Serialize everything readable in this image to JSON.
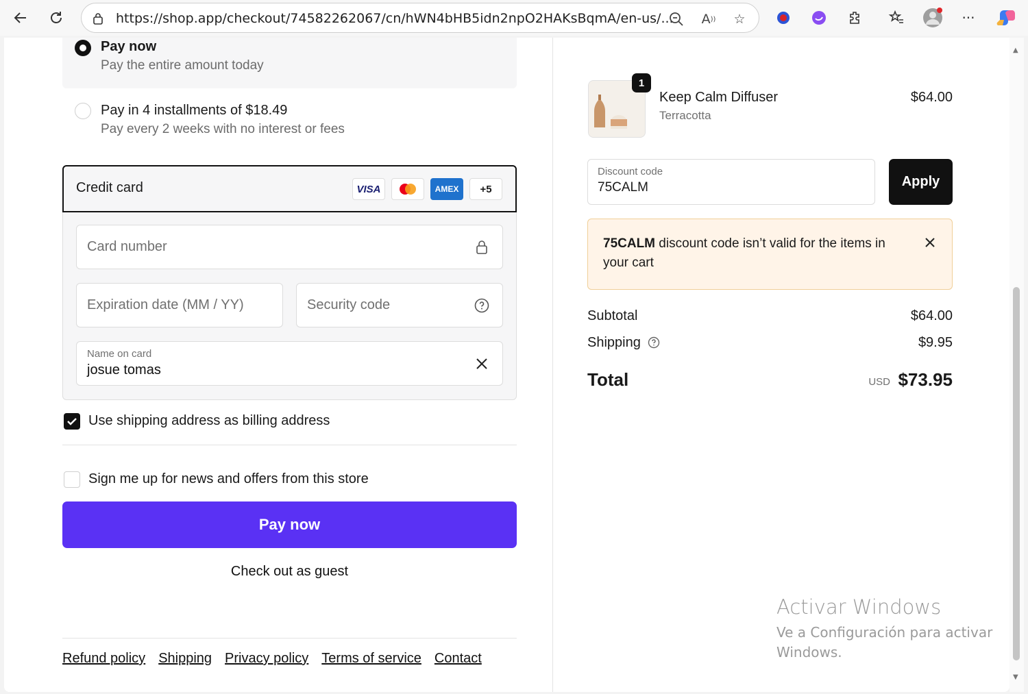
{
  "browser": {
    "url": "https://shop.app/checkout/74582262067/cn/hWN4bHB5idn2npO2HAKsBqmA/en-us/..."
  },
  "payment_options": [
    {
      "title": "Pay now",
      "subtitle": "Pay the entire amount today",
      "selected": true
    },
    {
      "title": "Pay in 4 installments of $18.49",
      "subtitle": "Pay every 2 weeks with no interest or fees",
      "selected": false
    }
  ],
  "credit_card": {
    "heading": "Credit card",
    "brands": [
      "VISA",
      "Mastercard",
      "AMEX",
      "+5"
    ],
    "card_number_placeholder": "Card number",
    "expiration_placeholder": "Expiration date (MM / YY)",
    "security_placeholder": "Security code",
    "name_label": "Name on card",
    "name_value": "josue tomas"
  },
  "billing_checkbox": {
    "label": "Use shipping address as billing address",
    "checked": true
  },
  "news_checkbox": {
    "label": "Sign me up for news and offers from this store",
    "checked": false
  },
  "pay_button": "Pay now",
  "guest_link": "Check out as guest",
  "footer": {
    "links": [
      "Refund policy",
      "Shipping",
      "Privacy policy",
      "Terms of service",
      "Contact"
    ]
  },
  "summary": {
    "item": {
      "name": "Keep Calm Diffuser",
      "variant": "Terracotta",
      "price": "$64.00",
      "quantity": "1"
    },
    "discount": {
      "label": "Discount code",
      "value": "75CALM",
      "apply": "Apply"
    },
    "alert": {
      "code": "75CALM",
      "message": "discount code isn’t valid for the items in your cart"
    },
    "subtotal_label": "Subtotal",
    "subtotal": "$64.00",
    "shipping_label": "Shipping",
    "shipping": "$9.95",
    "total_label": "Total",
    "currency": "USD",
    "total": "$73.95"
  },
  "watermark": {
    "title": "Activar Windows",
    "body": "Ve a Configuración para activar Windows."
  },
  "colors": {
    "accent": "#5a31f4",
    "alert_bg": "#fff4e8",
    "alert_border": "#f0cf98"
  }
}
